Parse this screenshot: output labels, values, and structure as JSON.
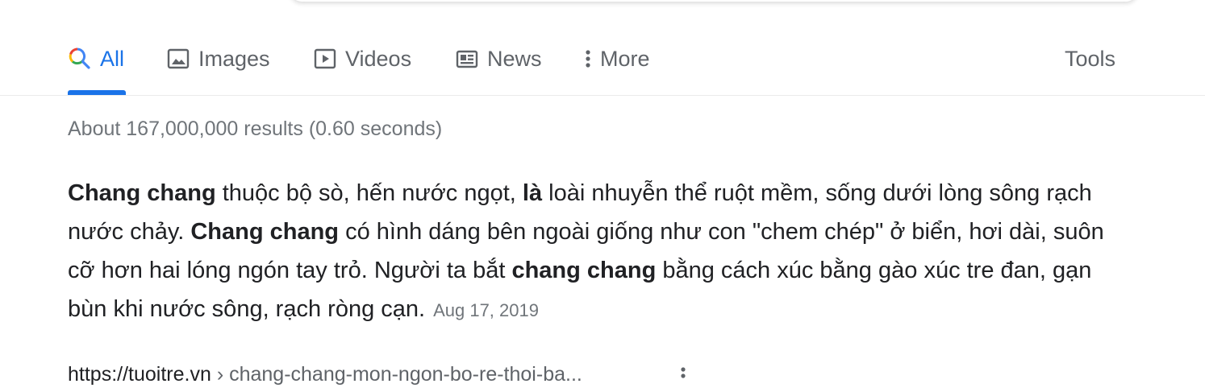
{
  "tabs": [
    {
      "label": "All",
      "icon": "google-search-icon",
      "active": true
    },
    {
      "label": "Images",
      "icon": "image-icon",
      "active": false
    },
    {
      "label": "Videos",
      "icon": "play-icon",
      "active": false
    },
    {
      "label": "News",
      "icon": "news-icon",
      "active": false
    },
    {
      "label": "More",
      "icon": "vertical-dots-icon",
      "active": false
    }
  ],
  "tools_label": "Tools",
  "result_stats": "About 167,000,000 results (0.60 seconds)",
  "snippet": {
    "parts": [
      {
        "text": "Chang chang",
        "bold": true
      },
      {
        "text": " thuộc bộ sò, hến nước ngọt, ",
        "bold": false
      },
      {
        "text": "là",
        "bold": true
      },
      {
        "text": " loài nhuyễn thể ruột mềm, sống dưới lòng sông rạch nước chảy. ",
        "bold": false
      },
      {
        "text": "Chang chang",
        "bold": true
      },
      {
        "text": " có hình dáng bên ngoài giống như con \"chem chép\" ở biển, hơi dài, suôn cỡ hơn hai lóng ngón tay trỏ. Người ta bắt ",
        "bold": false
      },
      {
        "text": "chang chang",
        "bold": true
      },
      {
        "text": " bằng cách xúc bằng gào xúc tre đan, gạn bùn khi nước sông, rạch ròng cạn.",
        "bold": false
      }
    ],
    "date": "Aug 17, 2019"
  },
  "result": {
    "site": "https://tuoitre.vn",
    "path": " › chang-chang-mon-ngon-bo-re-thoi-ba..."
  },
  "colors": {
    "accent": "#1a73e8",
    "muted": "#5f6368",
    "stats": "#70757a"
  }
}
